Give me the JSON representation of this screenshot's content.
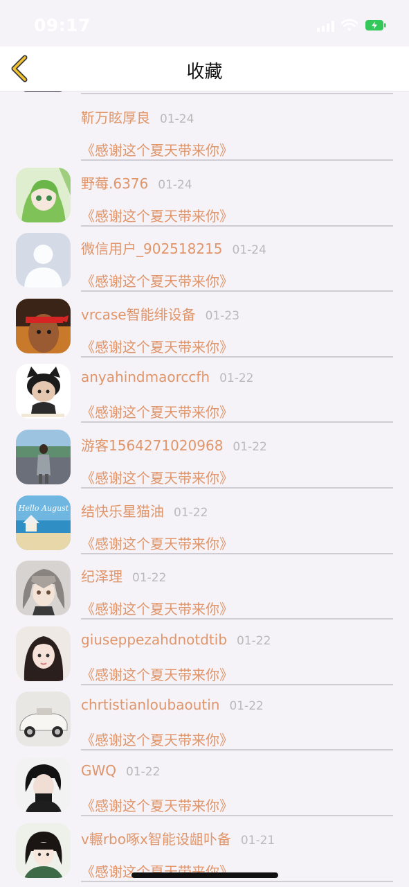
{
  "status": {
    "time": "09:17"
  },
  "nav": {
    "title": "收藏"
  },
  "items": [
    {
      "name": "靳万眩厚良",
      "date": "01-24",
      "title": "《感谢这个夏天带来你》",
      "avatar": "none"
    },
    {
      "name": "野莓.6376",
      "date": "01-24",
      "title": "《感谢这个夏天带来你》",
      "avatar": "anime-green"
    },
    {
      "name": "微信用户_902518215",
      "date": "01-24",
      "title": "《感谢这个夏天带来你》",
      "avatar": "default-silhouette"
    },
    {
      "name": "vrcase智能绯设备",
      "date": "01-23",
      "title": "《感谢这个夏天带来你》",
      "avatar": "red-headband"
    },
    {
      "name": "anyahindmaorccfh",
      "date": "01-22",
      "title": "《感谢这个夏天带来你》",
      "avatar": "cat-ear-doll"
    },
    {
      "name": "游客1564271020968",
      "date": "01-22",
      "title": "《感谢这个夏天带来你》",
      "avatar": "lake-person"
    },
    {
      "name": "结快乐星猫油",
      "date": "01-22",
      "title": "《感谢这个夏天带来你》",
      "avatar": "beach"
    },
    {
      "name": "纪泽理",
      "date": "01-22",
      "title": "《感谢这个夏天带来你》",
      "avatar": "anime-boy"
    },
    {
      "name": "giuseppezahdnotdtib",
      "date": "01-22",
      "title": "《感谢这个夏天带来你》",
      "avatar": "girl-portrait"
    },
    {
      "name": "chrtistianloubaoutin",
      "date": "01-22",
      "title": "《感谢这个夏天带来你》",
      "avatar": "vintage-car"
    },
    {
      "name": "GWQ",
      "date": "01-22",
      "title": "《感谢这个夏天带来你》",
      "avatar": "dark-hair-man"
    },
    {
      "name": "v輾rbo啄x智能设龃卟备",
      "date": "01-21",
      "title": "《感谢这个夏天带来你》",
      "avatar": "girl-bangs"
    }
  ],
  "colors": {
    "accent": "#e0956a",
    "date": "#b9b9b9",
    "background": "#f5f3f8"
  }
}
